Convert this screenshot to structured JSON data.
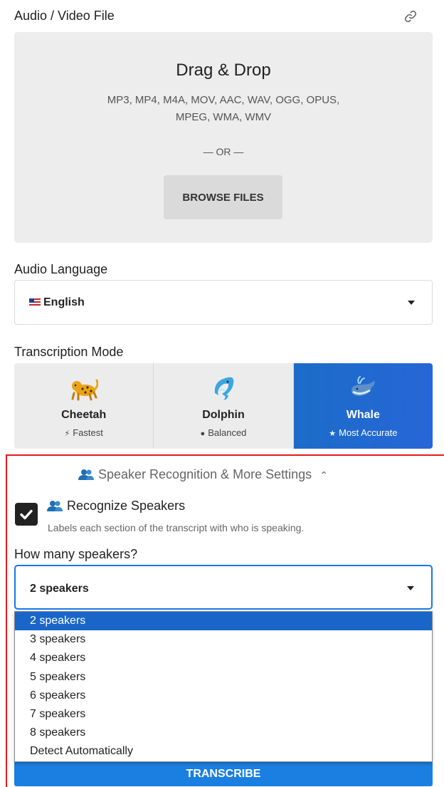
{
  "file_section": {
    "label": "Audio / Video File",
    "dropzone_title": "Drag & Drop",
    "formats": "MP3, MP4, M4A, MOV, AAC, WAV, OGG, OPUS, MPEG, WMA, WMV",
    "or_text": "— OR —",
    "browse_label": "BROWSE FILES"
  },
  "language": {
    "label": "Audio Language",
    "value": "English",
    "flag": "us-flag-icon"
  },
  "mode": {
    "label": "Transcription Mode",
    "options": [
      {
        "name": "Cheetah",
        "sub": "Fastest",
        "icon": "bolt-icon",
        "emoji": "leopard",
        "active": false
      },
      {
        "name": "Dolphin",
        "sub": "Balanced",
        "icon": "check-circle-icon",
        "emoji": "dolphin",
        "active": false
      },
      {
        "name": "Whale",
        "sub": "Most Accurate",
        "icon": "star-icon",
        "emoji": "whale",
        "active": true
      }
    ],
    "active_color": "#2766d6"
  },
  "speaker_settings": {
    "toggle_label": "Speaker Recognition & More Settings",
    "toggle_icon": "chevron-up-icon",
    "recognize_label": "Recognize Speakers",
    "recognize_desc": "Labels each section of the transcript with who is speaking.",
    "recognize_checked": true,
    "howmany_label": "How many speakers?",
    "selected": "2 speakers",
    "options": [
      "2 speakers",
      "3 speakers",
      "4 speakers",
      "5 speakers",
      "6 speakers",
      "7 speakers",
      "8 speakers",
      "Detect Automatically"
    ],
    "highlight_color": "#1966c8"
  },
  "submit": {
    "label": "TRANSCRIBE"
  },
  "colors": {
    "accent": "#1677e5",
    "outline": "#e41b1b"
  }
}
